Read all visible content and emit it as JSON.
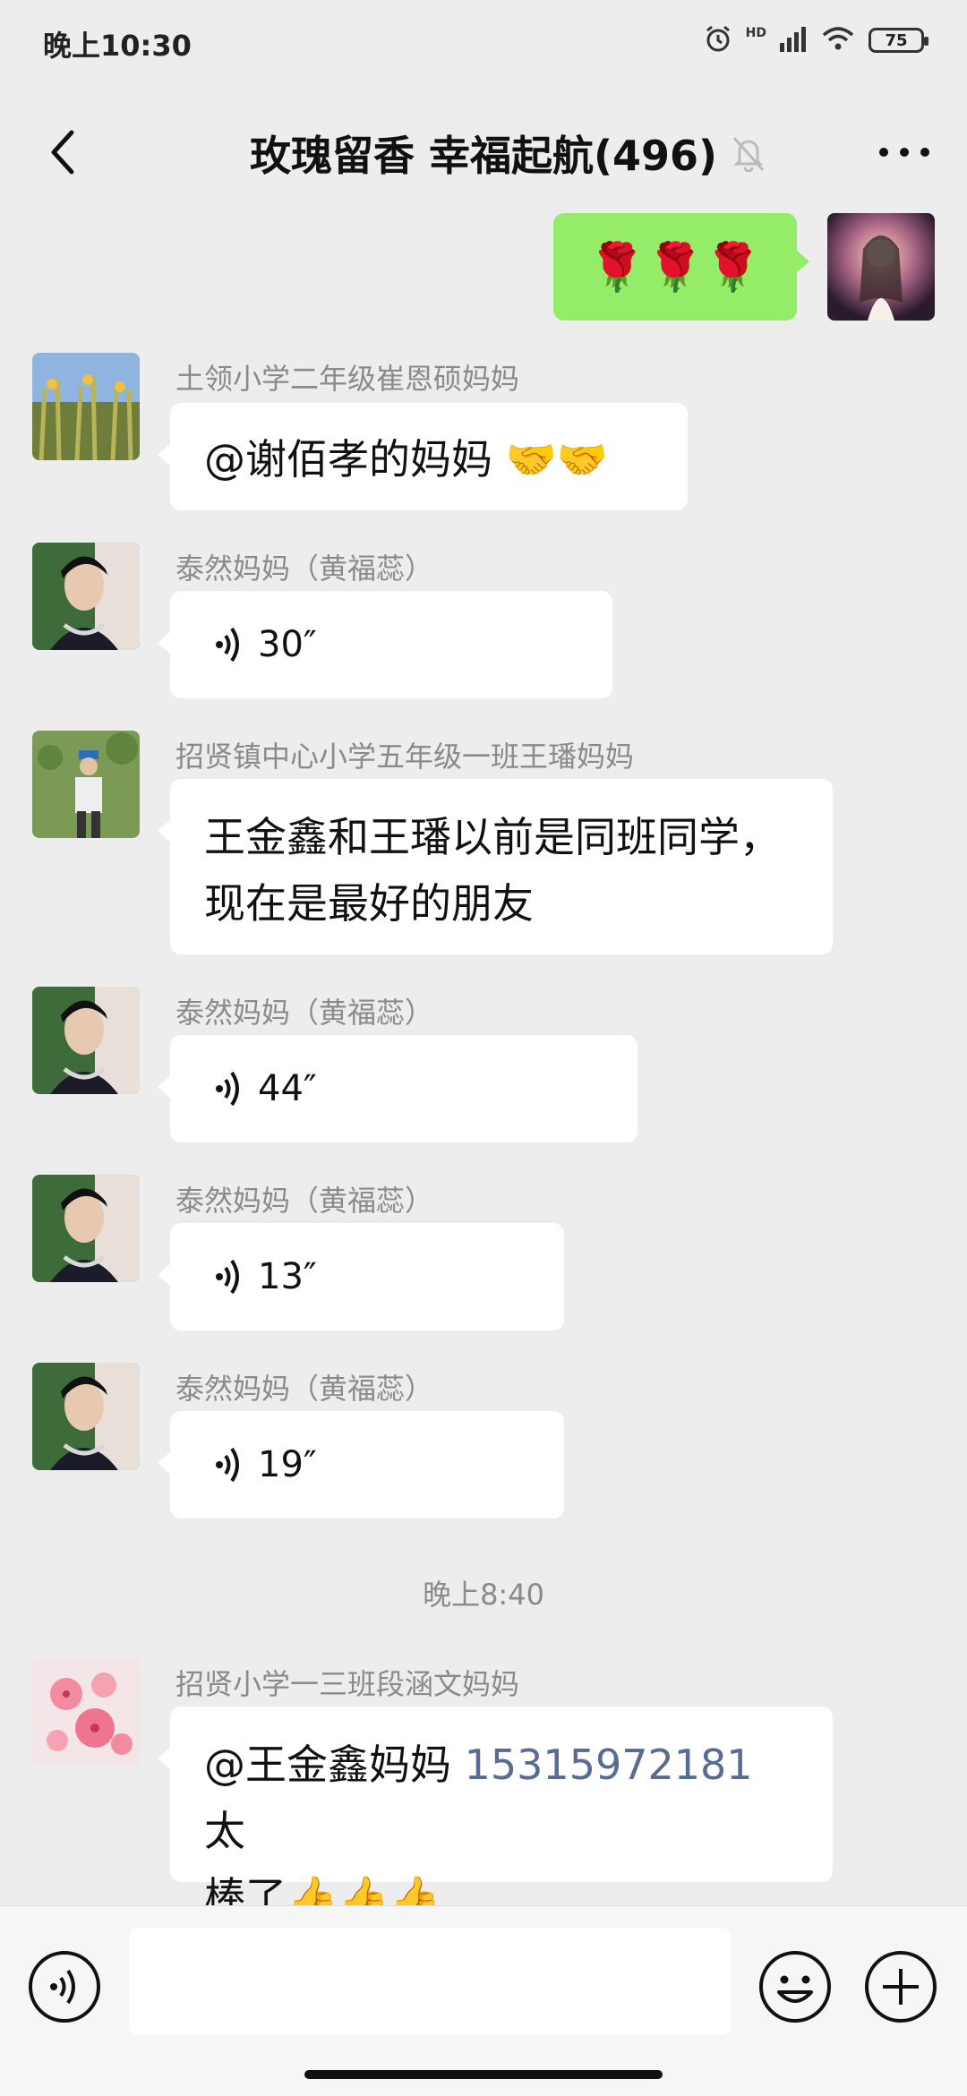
{
  "status": {
    "time": "晚上10:30",
    "hd": "HD",
    "battery": "75"
  },
  "header": {
    "title": "玫瑰留香  幸福起航(496)"
  },
  "messages": {
    "self_emoji": "🌹🌹🌹",
    "m1": {
      "sender": "土领小学二年级崔恩硕妈妈",
      "text": "@谢佰孝的妈妈 🤝🤝"
    },
    "m2": {
      "sender": "泰然妈妈（黄福蕊）",
      "duration": "30″"
    },
    "m3": {
      "sender": "招贤镇中心小学五年级一班王璠妈妈",
      "line1": "王金鑫和王璠以前是同班同学，",
      "line2": "现在是最好的朋友"
    },
    "m4": {
      "sender": "泰然妈妈（黄福蕊）",
      "duration": "44″"
    },
    "m5": {
      "sender": "泰然妈妈（黄福蕊）",
      "duration": "13″"
    },
    "m6": {
      "sender": "泰然妈妈（黄福蕊）",
      "duration": "19″"
    },
    "time_divider": "晚上8:40",
    "m7": {
      "sender": "招贤小学一三班段涵文妈妈",
      "prefix": "@王金鑫妈妈 ",
      "phone": "15315972181",
      "suffix": " 太",
      "line2": "棒了👍👍👍"
    }
  },
  "input": {
    "value": ""
  },
  "icons": {
    "back": "back-arrow-icon",
    "mute": "bell-muted-icon",
    "more": "more-dots-icon",
    "voice": "voice-wave-icon",
    "emoji": "smiley-icon",
    "plus": "plus-icon"
  },
  "colors": {
    "background": "#ededed",
    "self_bubble": "#95ec69",
    "link": "#576b95"
  }
}
